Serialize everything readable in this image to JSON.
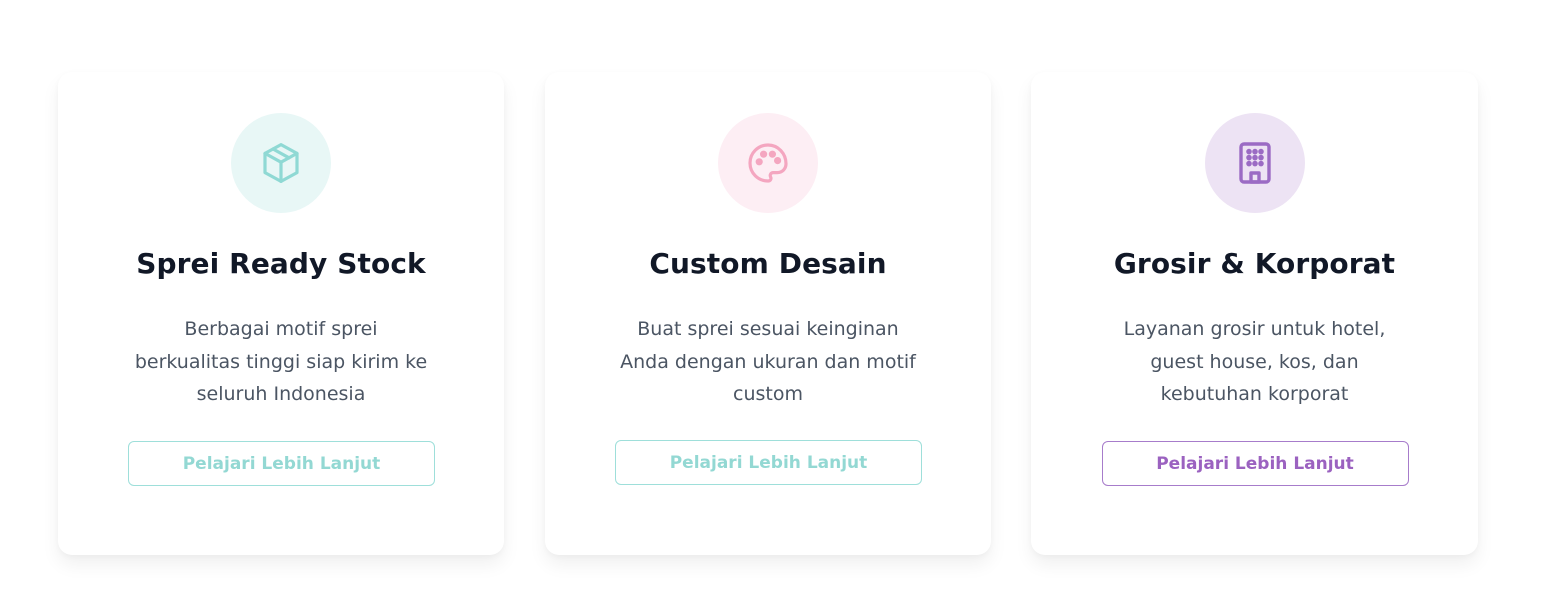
{
  "cards": [
    {
      "title": "Sprei Ready Stock",
      "description": "Berbagai motif sprei berkualitas tinggi siap kirim ke seluruh Indonesia",
      "button_label": "Pelajari Lebih Lanjut",
      "icon": "box-icon",
      "accent_color": "#8fd9d4",
      "icon_bg": "#e8f7f6",
      "button_text_color": "#93d8d3",
      "button_border_color": "#9edfda"
    },
    {
      "title": "Custom Desain",
      "description": "Buat sprei sesuai keinginan Anda dengan ukuran dan motif custom",
      "button_label": "Pelajari Lebih Lanjut",
      "icon": "palette-icon",
      "accent_color": "#f4a6c0",
      "icon_bg": "#fdeef4",
      "button_text_color": "#93d8d3",
      "button_border_color": "#9edfda"
    },
    {
      "title": "Grosir & Korporat",
      "description": "Layanan grosir untuk hotel, guest house, kos, dan kebutuhan korporat",
      "button_label": "Pelajari Lebih Lanjut",
      "icon": "building-icon",
      "accent_color": "#9b6bc4",
      "icon_bg": "#ede3f4",
      "button_text_color": "#9b62c0",
      "button_border_color": "#a77ccb"
    }
  ]
}
